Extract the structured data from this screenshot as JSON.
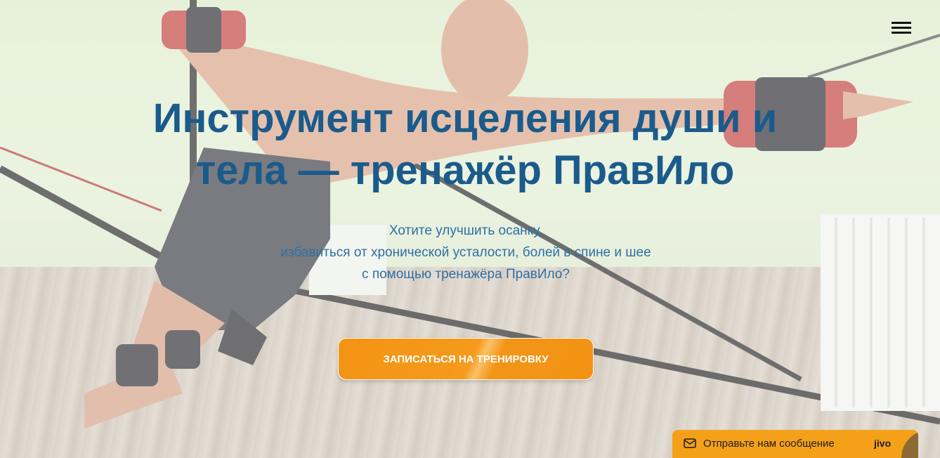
{
  "hero": {
    "title_line1": "Инструмент исцеления души и",
    "title_line2": "тела — тренажёр ПравИло",
    "subtitle_lines": [
      "Хотите улучшить осанку,",
      "избавиться от хронической усталости, болей в спине и шее",
      "с помощью тренажёра ПравИло?"
    ],
    "cta_label": "Записаться на тренировку"
  },
  "header": {
    "menu_icon": "hamburger-menu-icon"
  },
  "chat_widget": {
    "label": "Отправьте нам сообщение",
    "brand": "jivo",
    "icon": "envelope-icon"
  },
  "colors": {
    "title": "#1b5b8c",
    "subtitle": "#2f6fa4",
    "cta": "#f39314",
    "chat": "#f5a019"
  }
}
